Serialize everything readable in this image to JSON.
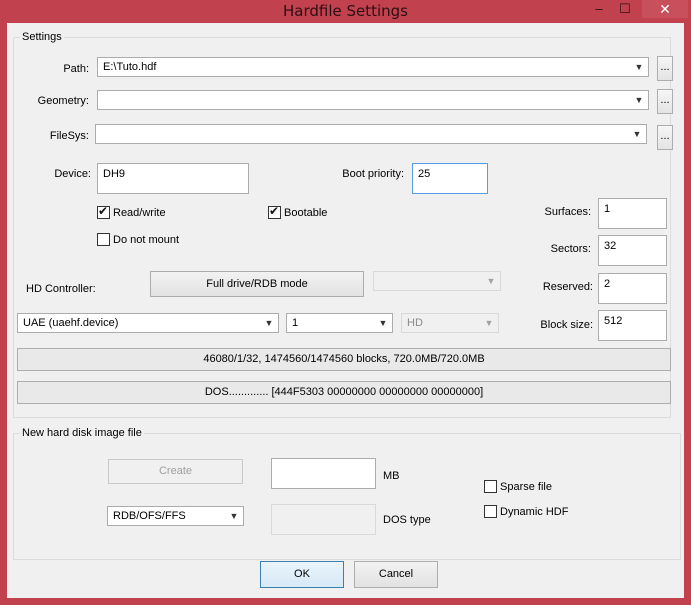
{
  "window": {
    "title": "Hardfile Settings",
    "minimize": "‒",
    "maximize": "☐",
    "close": "✕"
  },
  "settings": {
    "group_label": "Settings",
    "path_label": "Path:",
    "path_value": "E:\\Tuto.hdf",
    "geometry_label": "Geometry:",
    "geometry_value": "",
    "filesys_label": "FileSys:",
    "filesys_value": "",
    "browse_label": "...",
    "device_label": "Device:",
    "device_value": "DH9",
    "boot_priority_label": "Boot priority:",
    "boot_priority_value": "25",
    "read_write_label": "Read/write",
    "read_write_checked": true,
    "bootable_label": "Bootable",
    "bootable_checked": true,
    "do_not_mount_label": "Do not mount",
    "do_not_mount_checked": false,
    "surfaces_label": "Surfaces:",
    "surfaces_value": "1",
    "sectors_label": "Sectors:",
    "sectors_value": "32",
    "reserved_label": "Reserved:",
    "reserved_value": "2",
    "block_size_label": "Block size:",
    "block_size_value": "512",
    "hd_controller_label": "HD Controller:",
    "full_drive_button": "Full drive/RDB mode",
    "controller_value": "UAE (uaehf.device)",
    "unit_value": "1",
    "interface_value": "HD",
    "geometry_info": "46080/1/32, 1474560/1474560 blocks, 720.0MB/720.0MB",
    "dos_info": "DOS............. [444F5303 00000000 00000000 00000000]"
  },
  "new_image": {
    "group_label": "New hard disk image file",
    "create_button": "Create",
    "size_value": "",
    "mb_label": "MB",
    "fs_value": "RDB/OFS/FFS",
    "dos_type_value": "",
    "dos_type_label": "DOS type",
    "sparse_label": "Sparse file",
    "sparse_checked": false,
    "dynamic_label": "Dynamic HDF",
    "dynamic_checked": false
  },
  "footer": {
    "ok_label": "OK",
    "cancel_label": "Cancel"
  },
  "icons": {
    "dropdown": "chevron-down-icon",
    "check": "check-icon"
  }
}
